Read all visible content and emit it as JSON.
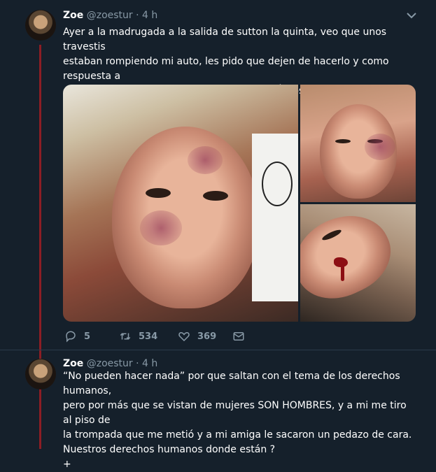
{
  "tweets": [
    {
      "name": "Zoe",
      "handle": "@zoestur",
      "separator": "·",
      "time": "4 h",
      "text": "Ayer a la madrugada a la salida de sutton la quinta, veo que unos travestis\nestaban rompiendo mi auto, les pido que dejen de hacerlo y como respuesta a\neso nos cagan a palos. La policia PRESENCIÓ absolutamente todo y NO HIZO\nNADA “no podemos hacer nada nosotros” como respuesta.",
      "actions": {
        "reply_count": "5",
        "retweet_count": "534",
        "like_count": "369"
      }
    },
    {
      "name": "Zoe",
      "handle": "@zoestur",
      "separator": "·",
      "time": "4 h",
      "text": "“No pueden hacer nada” por que saltan con el tema de los derechos humanos,\npero por más que se vistan de mujeres SON HOMBRES, y a mi me tiro al piso de\nla trompada que me metió y a mi amiga le sacaron un pedazo de cara.\nNuestros derechos humanos donde están ?\n+"
    }
  ],
  "icons": {
    "caret": "chevron-down-icon",
    "reply": "reply-icon",
    "retweet": "retweet-icon",
    "like": "heart-icon",
    "message": "envelope-icon"
  },
  "colors": {
    "background": "#15202b",
    "secondary_text": "#8899a6",
    "thread_line": "#8c1d24"
  }
}
